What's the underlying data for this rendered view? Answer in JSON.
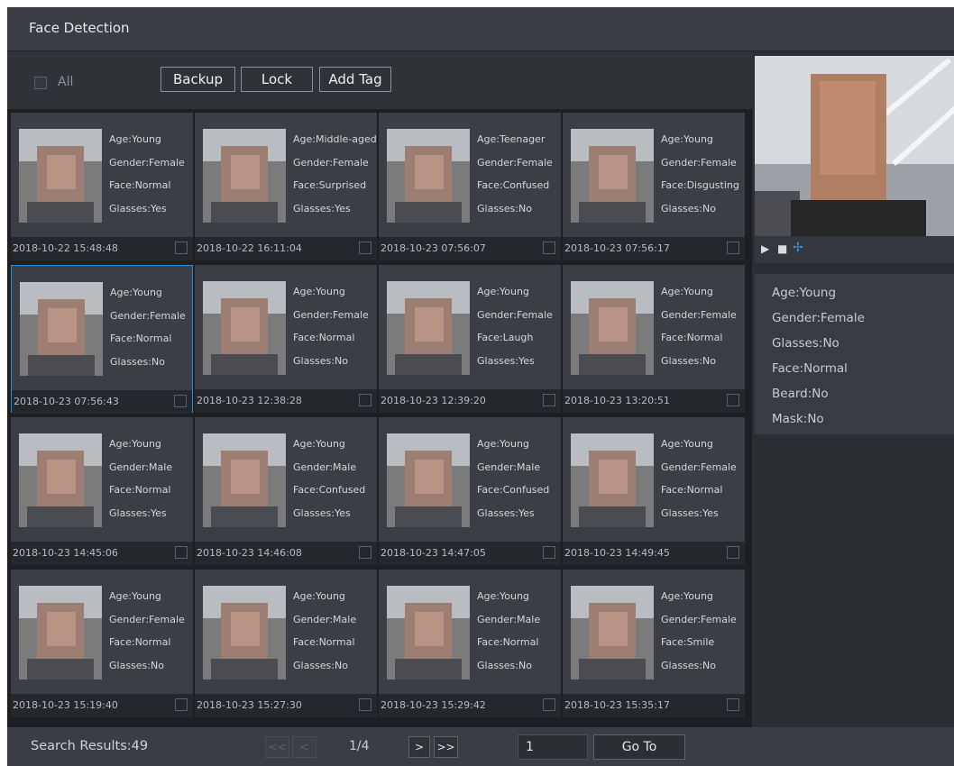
{
  "window": {
    "title": "Face Detection"
  },
  "toolbar": {
    "all_label": "All",
    "backup_label": "Backup",
    "lock_label": "Lock",
    "add_tag_label": "Add Tag"
  },
  "results": [
    {
      "age": "Age:Young",
      "gender": "Gender:Female",
      "face": "Face:Normal",
      "glasses": "Glasses:Yes",
      "time": "2018-10-22 15:48:48"
    },
    {
      "age": "Age:Middle-aged",
      "gender": "Gender:Female",
      "face": "Face:Surprised",
      "glasses": "Glasses:Yes",
      "time": "2018-10-22 16:11:04"
    },
    {
      "age": "Age:Teenager",
      "gender": "Gender:Female",
      "face": "Face:Confused",
      "glasses": "Glasses:No",
      "time": "2018-10-23 07:56:07"
    },
    {
      "age": "Age:Young",
      "gender": "Gender:Female",
      "face": "Face:Disgusting",
      "glasses": "Glasses:No",
      "time": "2018-10-23 07:56:17"
    },
    {
      "age": "Age:Young",
      "gender": "Gender:Female",
      "face": "Face:Normal",
      "glasses": "Glasses:No",
      "time": "2018-10-23 07:56:43"
    },
    {
      "age": "Age:Young",
      "gender": "Gender:Female",
      "face": "Face:Normal",
      "glasses": "Glasses:No",
      "time": "2018-10-23 12:38:28"
    },
    {
      "age": "Age:Young",
      "gender": "Gender:Female",
      "face": "Face:Laugh",
      "glasses": "Glasses:Yes",
      "time": "2018-10-23 12:39:20"
    },
    {
      "age": "Age:Young",
      "gender": "Gender:Female",
      "face": "Face:Normal",
      "glasses": "Glasses:No",
      "time": "2018-10-23 13:20:51"
    },
    {
      "age": "Age:Young",
      "gender": "Gender:Male",
      "face": "Face:Normal",
      "glasses": "Glasses:Yes",
      "time": "2018-10-23 14:45:06"
    },
    {
      "age": "Age:Young",
      "gender": "Gender:Male",
      "face": "Face:Confused",
      "glasses": "Glasses:Yes",
      "time": "2018-10-23 14:46:08"
    },
    {
      "age": "Age:Young",
      "gender": "Gender:Male",
      "face": "Face:Confused",
      "glasses": "Glasses:Yes",
      "time": "2018-10-23 14:47:05"
    },
    {
      "age": "Age:Young",
      "gender": "Gender:Female",
      "face": "Face:Normal",
      "glasses": "Glasses:Yes",
      "time": "2018-10-23 14:49:45"
    },
    {
      "age": "Age:Young",
      "gender": "Gender:Female",
      "face": "Face:Normal",
      "glasses": "Glasses:No",
      "time": "2018-10-23 15:19:40"
    },
    {
      "age": "Age:Young",
      "gender": "Gender:Male",
      "face": "Face:Normal",
      "glasses": "Glasses:No",
      "time": "2018-10-23 15:27:30"
    },
    {
      "age": "Age:Young",
      "gender": "Gender:Male",
      "face": "Face:Normal",
      "glasses": "Glasses:No",
      "time": "2018-10-23 15:29:42"
    },
    {
      "age": "Age:Young",
      "gender": "Gender:Female",
      "face": "Face:Smile",
      "glasses": "Glasses:No",
      "time": "2018-10-23 15:35:17"
    }
  ],
  "selected_index": 4,
  "details": {
    "age": "Age:Young",
    "gender": "Gender:Female",
    "glasses": "Glasses:No",
    "face": "Face:Normal",
    "beard": "Beard:No",
    "mask": "Mask:No"
  },
  "pagination": {
    "results_text": "Search Results:49",
    "first_label": "<<",
    "prev_label": "<",
    "page_text": "1/4",
    "next_label": ">",
    "last_label": ">>",
    "page_value": "1",
    "goto_label": "Go To"
  },
  "icons": {
    "play": "play-icon",
    "stop": "stop-icon",
    "smart-search": "smart-search-icon"
  },
  "colors": {
    "accent": "#2e8bd8"
  }
}
